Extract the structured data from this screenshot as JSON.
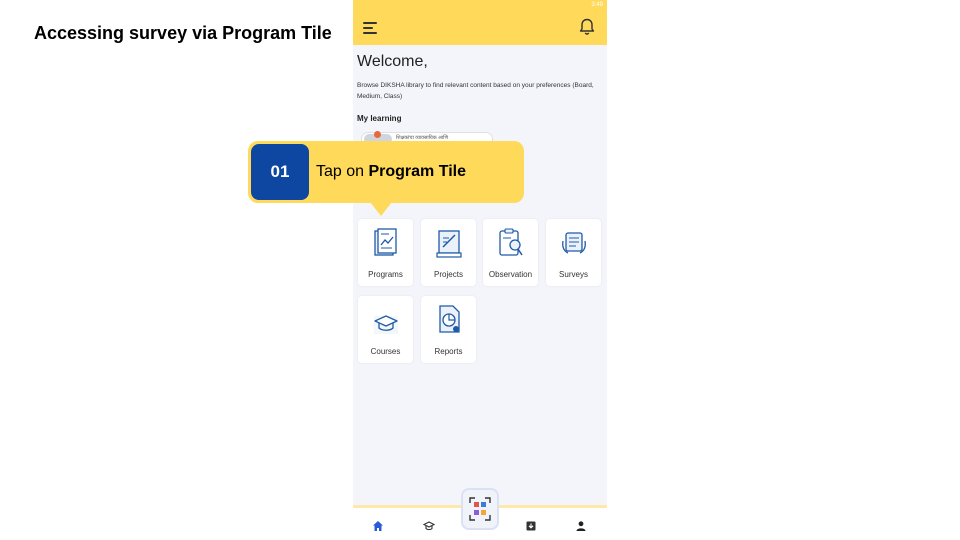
{
  "slide": {
    "title": "Accessing survey via Program Tile"
  },
  "app": {
    "status_time": "3:49",
    "welcome": "Welcome,",
    "browse_text": "Browse DIKSHA library to find relevant content based on your preferences (Board, Medium, Class)",
    "my_learning": "My learning",
    "chip_text": "शिक्षकांचा व्यावसायिक आणि",
    "tiles": [
      {
        "label": "Programs",
        "icon": "programs-icon"
      },
      {
        "label": "Projects",
        "icon": "projects-icon"
      },
      {
        "label": "Observation",
        "icon": "observation-icon"
      },
      {
        "label": "Surveys",
        "icon": "surveys-icon"
      },
      {
        "label": "Courses",
        "icon": "courses-icon"
      },
      {
        "label": "Reports",
        "icon": "reports-icon"
      }
    ],
    "bottom_nav": [
      "home-icon",
      "courses-nav-icon",
      "qr-scan-icon",
      "downloads-icon",
      "profile-icon"
    ],
    "colors": {
      "appbar": "#ffd95a",
      "icon_blue": "#1f5aa6",
      "active_nav": "#2a5bd7"
    }
  },
  "callout": {
    "step": "01",
    "prefix": "Tap on ",
    "emphasis": "Program Tile"
  }
}
